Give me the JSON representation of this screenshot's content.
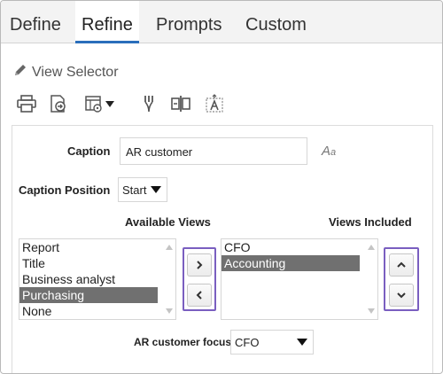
{
  "tabs": [
    {
      "label": "Define",
      "active": false
    },
    {
      "label": "Refine",
      "active": true
    },
    {
      "label": "Prompts",
      "active": false
    },
    {
      "label": "Custom",
      "active": false
    }
  ],
  "view_selector": {
    "label": "View Selector",
    "icon": "pencil-icon"
  },
  "toolbar": {
    "icons": [
      "print-icon",
      "export-icon",
      "view-options-icon",
      "chevron-down-icon",
      "merge-icon",
      "split-icon",
      "text-format-icon"
    ]
  },
  "caption": {
    "label": "Caption",
    "value": "AR customer",
    "format_glyph": "A",
    "format_glyph_small": "a"
  },
  "caption_position": {
    "label": "Caption Position",
    "value": "Start"
  },
  "available_views": {
    "label": "Available Views",
    "items": [
      "Report",
      "Title",
      "Business analyst",
      "Purchasing",
      "None"
    ],
    "selected": "Purchasing"
  },
  "views_included": {
    "label": "Views Included",
    "items": [
      "CFO",
      "Accounting"
    ],
    "selected": "Accounting"
  },
  "focus": {
    "label": "AR customer focus",
    "value": "CFO"
  },
  "colors": {
    "accent": "#2a6ebb",
    "highlight_border": "#7a5fc0",
    "selected_row": "#707070"
  }
}
